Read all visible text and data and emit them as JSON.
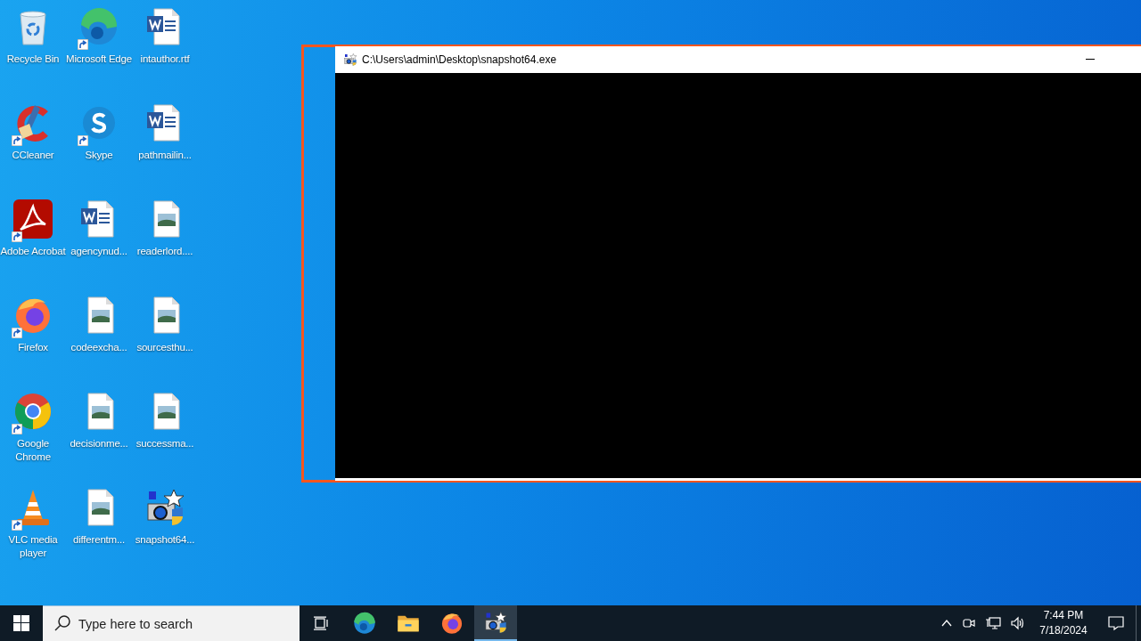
{
  "desktop": {
    "icons": [
      {
        "kind": "recycle-bin",
        "label": "Recycle Bin",
        "shortcut": false
      },
      {
        "kind": "ccleaner",
        "label": "CCleaner",
        "shortcut": true
      },
      {
        "kind": "acrobat",
        "label": "Adobe Acrobat",
        "shortcut": true
      },
      {
        "kind": "firefox",
        "label": "Firefox",
        "shortcut": true
      },
      {
        "kind": "chrome",
        "label": "Google Chrome",
        "shortcut": true
      },
      {
        "kind": "vlc",
        "label": "VLC media player",
        "shortcut": true
      },
      {
        "kind": "edge",
        "label": "Microsoft Edge",
        "shortcut": true
      },
      {
        "kind": "skype",
        "label": "Skype",
        "shortcut": true
      },
      {
        "kind": "word",
        "label": "agencynud...",
        "shortcut": false
      },
      {
        "kind": "image",
        "label": "codeexcha...",
        "shortcut": false
      },
      {
        "kind": "image",
        "label": "decisionme...",
        "shortcut": false
      },
      {
        "kind": "image",
        "label": "differentm...",
        "shortcut": false
      },
      {
        "kind": "word",
        "label": "intauthor.rtf",
        "shortcut": false
      },
      {
        "kind": "word",
        "label": "pathmailin...",
        "shortcut": false
      },
      {
        "kind": "image",
        "label": "readerlord....",
        "shortcut": false
      },
      {
        "kind": "image",
        "label": "sourcesthu...",
        "shortcut": false
      },
      {
        "kind": "image",
        "label": "successma...",
        "shortcut": false
      },
      {
        "kind": "snapshot",
        "label": "snapshot64...",
        "shortcut": false
      }
    ]
  },
  "console_window": {
    "title": "C:\\Users\\admin\\Desktop\\snapshot64.exe",
    "highlighted": true
  },
  "taskbar": {
    "search": {
      "placeholder": "Type here to search"
    },
    "apps": [
      {
        "kind": "task-view",
        "selected": false
      },
      {
        "kind": "edge",
        "selected": false
      },
      {
        "kind": "folder",
        "selected": false
      },
      {
        "kind": "firefox",
        "selected": false
      },
      {
        "kind": "snapshot",
        "selected": true
      }
    ],
    "clock": {
      "time": "7:44 PM",
      "date": "7/18/2024"
    }
  }
}
